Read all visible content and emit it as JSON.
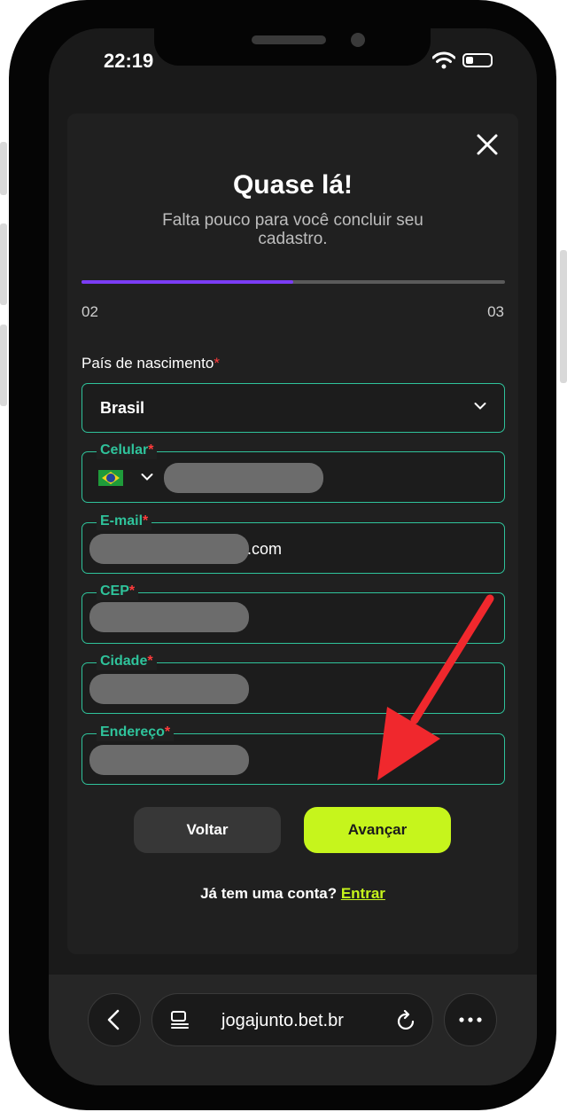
{
  "status_bar": {
    "time": "22:19"
  },
  "modal": {
    "title": "Quase lá!",
    "subtitle": "Falta pouco para você concluir seu cadastro.",
    "progress": {
      "value": 0.5,
      "color": "#7b3cf5",
      "step_current": "02",
      "step_total": "03"
    }
  },
  "form": {
    "country": {
      "label": "País de nascimento",
      "required_mark": "*",
      "value": "Brasil"
    },
    "phone": {
      "label": "Celular",
      "required_mark": "*",
      "country_flag": "brazil-flag-icon"
    },
    "email": {
      "label": "E-mail",
      "required_mark": "*",
      "visible_suffix": ".com"
    },
    "cep": {
      "label": "CEP",
      "required_mark": "*"
    },
    "city": {
      "label": "Cidade",
      "required_mark": "*"
    },
    "address": {
      "label": "Endereço",
      "required_mark": "*"
    }
  },
  "buttons": {
    "back": "Voltar",
    "next": "Avançar"
  },
  "login": {
    "prompt": "Já tem uma conta?",
    "link": "Entrar"
  },
  "browser": {
    "url": "jogajunto.bet.br"
  },
  "colors": {
    "accent": "#c6f51c",
    "field_border": "#2fc39b",
    "annotation_arrow": "#f0282d"
  }
}
